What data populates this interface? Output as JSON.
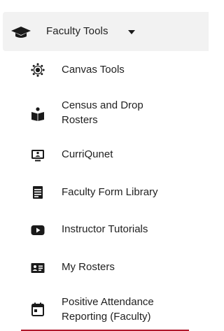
{
  "menu": {
    "title": "Faculty Tools",
    "items": [
      {
        "label": "Canvas Tools",
        "icon": "canvas-icon"
      },
      {
        "label": "Census and Drop\nRosters",
        "icon": "book-person-icon"
      },
      {
        "label": "CurriQunet",
        "icon": "screen-person-icon"
      },
      {
        "label": "Faculty Form Library",
        "icon": "form-document-icon"
      },
      {
        "label": "Instructor Tutorials",
        "icon": "video-play-icon"
      },
      {
        "label": "My Rosters",
        "icon": "id-card-icon"
      },
      {
        "label": "Positive Attendance\nReporting (Faculty)",
        "icon": "calendar-icon"
      }
    ]
  },
  "colors": {
    "header_bg": "#f2f2f2",
    "text": "#1f1f1f",
    "icon": "#1a1a1a",
    "accent_underline": "#b0162a"
  }
}
